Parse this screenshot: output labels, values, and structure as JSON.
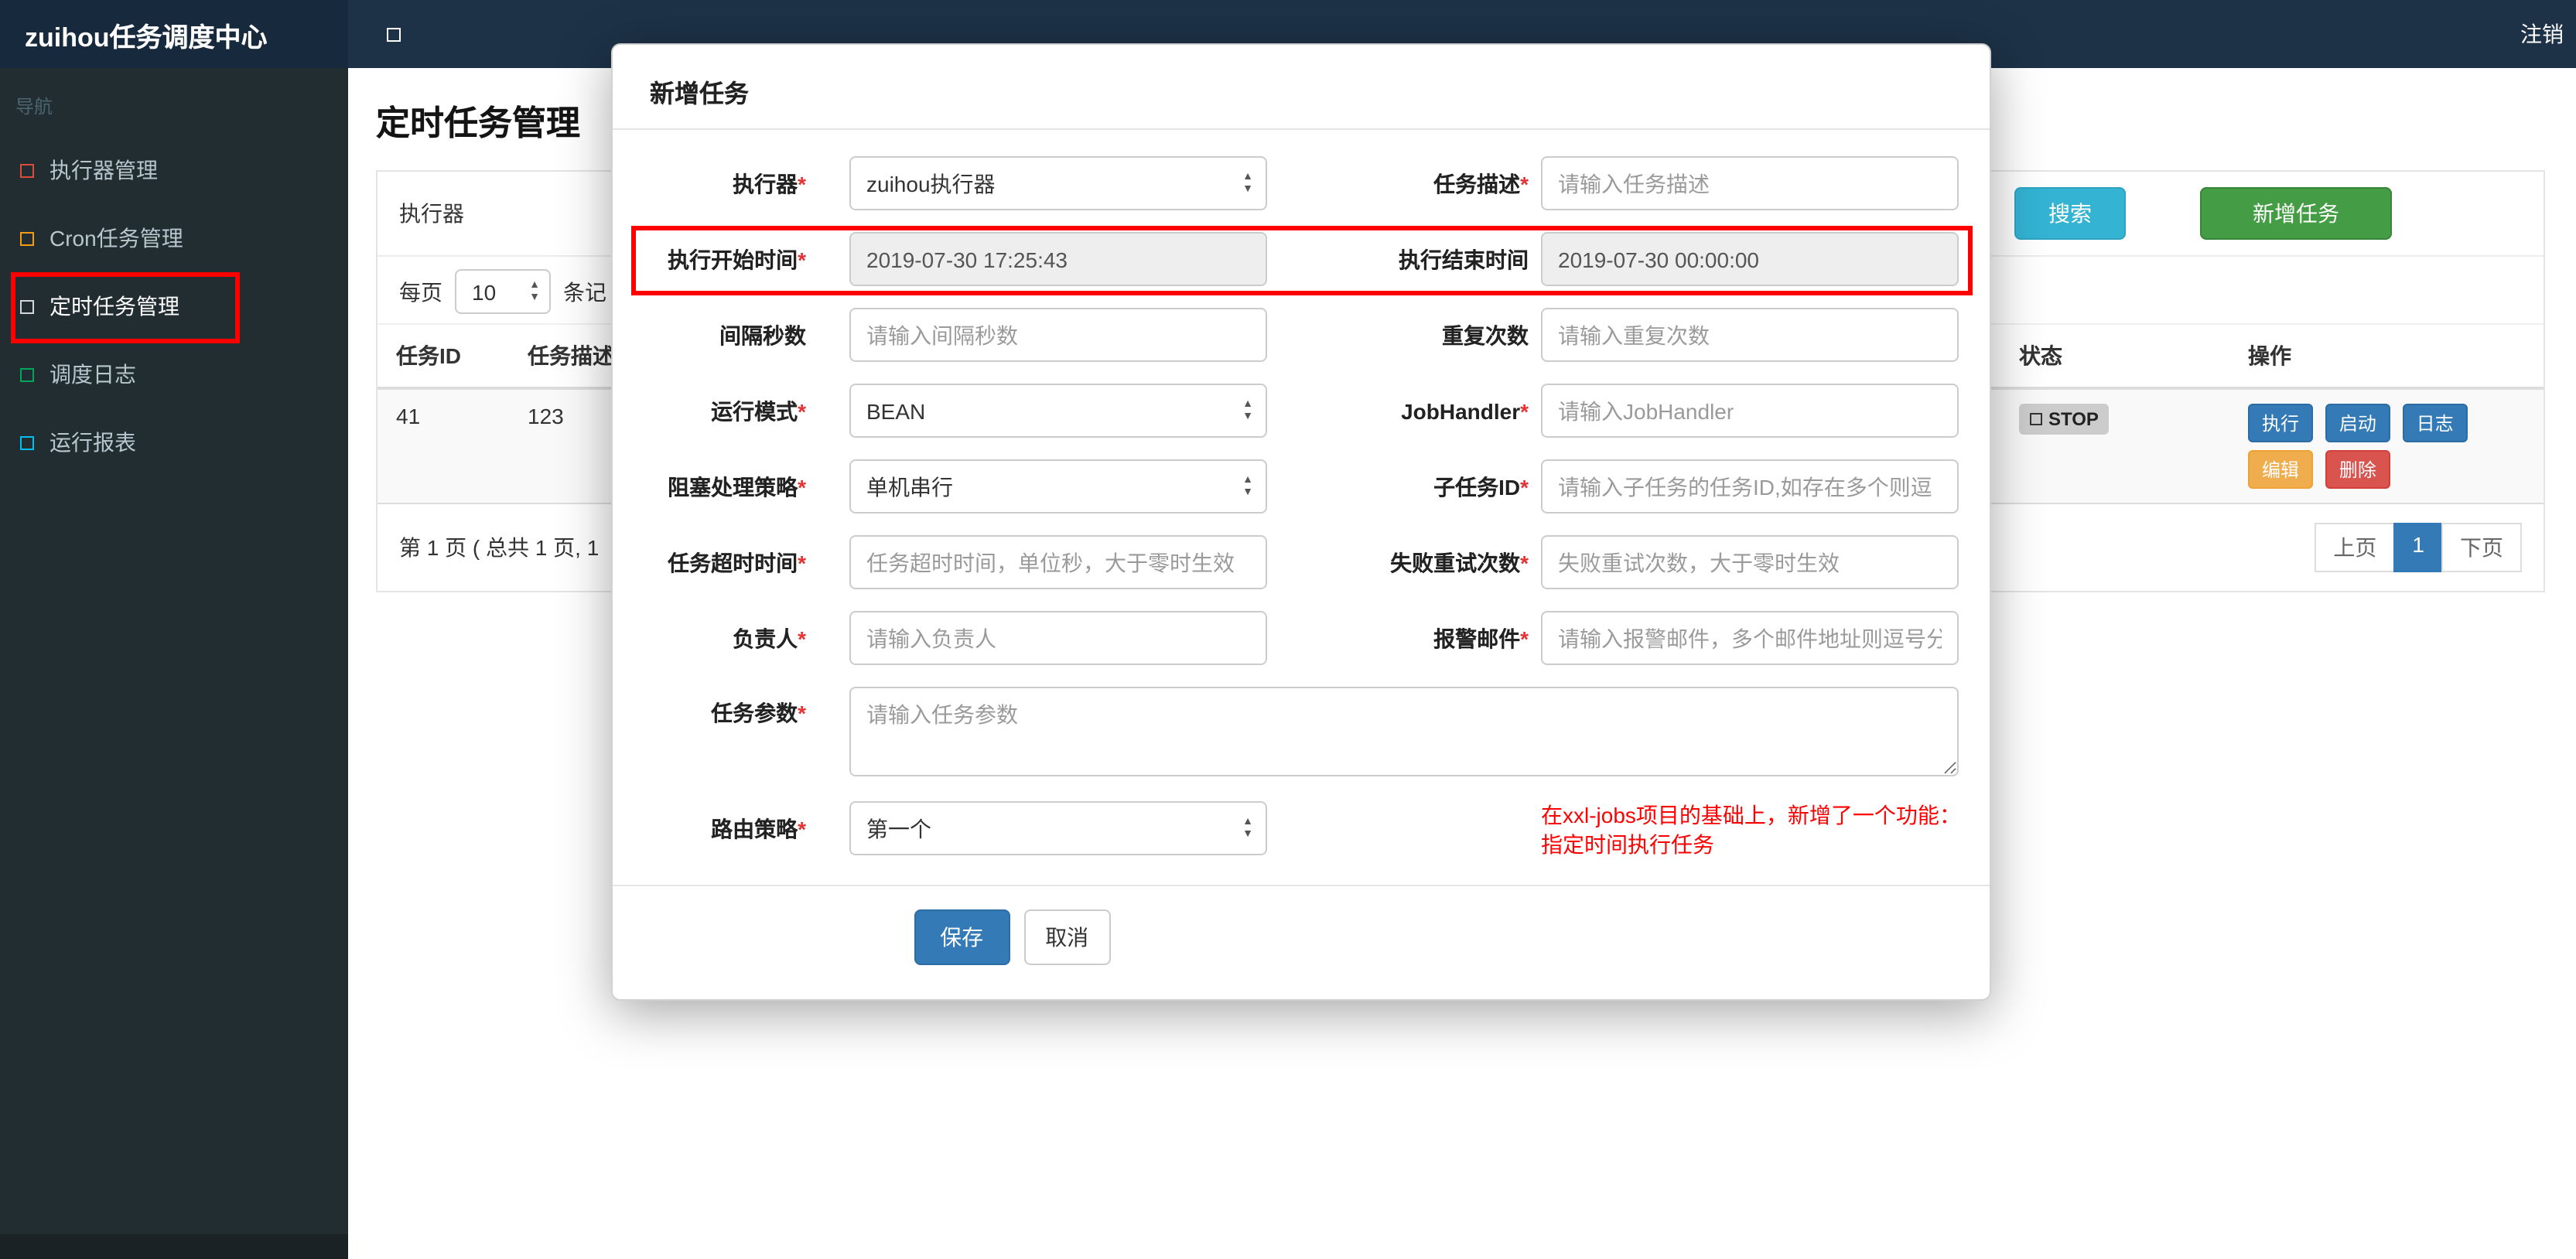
{
  "topbar": {
    "brand": "zuihou任务调度中心",
    "logout": "注销"
  },
  "sidebar": {
    "section_title": "导航",
    "items": [
      {
        "label": "执行器管理",
        "icon": "square-outline-icon",
        "icon_color": "#dd4b39"
      },
      {
        "label": "Cron任务管理",
        "icon": "square-outline-icon",
        "icon_color": "#f39c12"
      },
      {
        "label": "定时任务管理",
        "icon": "square-outline-icon",
        "icon_color": "#d2d6de",
        "annotated": true
      },
      {
        "label": "调度日志",
        "icon": "square-outline-icon",
        "icon_color": "#00a65a"
      },
      {
        "label": "运行报表",
        "icon": "square-outline-icon",
        "icon_color": "#00c0ef"
      }
    ]
  },
  "page": {
    "title": "定时任务管理",
    "filter": {
      "executor_label": "执行器",
      "search_button": "搜索",
      "add_button": "新增任务"
    },
    "per_page": {
      "prefix": "每页",
      "value": "10",
      "suffix": "条记"
    },
    "table": {
      "headers": [
        "任务ID",
        "任务描述",
        "状态",
        "操作"
      ],
      "rows": [
        {
          "id": "41",
          "desc": "123",
          "status": "STOP",
          "actions": [
            "执行",
            "启动",
            "日志",
            "编辑",
            "删除"
          ]
        }
      ]
    },
    "pagination": {
      "info": "第 1 页 ( 总共 1 页, 1",
      "prev": "上页",
      "current": "1",
      "next": "下页"
    }
  },
  "modal": {
    "title": "新增任务",
    "fields": {
      "executor": {
        "label": "执行器",
        "required": "*",
        "value": "zuihou执行器"
      },
      "job_desc": {
        "label": "任务描述",
        "required": "*",
        "placeholder": "请输入任务描述"
      },
      "start_time": {
        "label": "执行开始时间",
        "required": "*",
        "value": "2019-07-30 17:25:43"
      },
      "end_time": {
        "label": "执行结束时间",
        "value": "2019-07-30 00:00:00"
      },
      "interval_seconds": {
        "label": "间隔秒数",
        "placeholder": "请输入间隔秒数"
      },
      "repeat_count": {
        "label": "重复次数",
        "placeholder": "请输入重复次数"
      },
      "run_mode": {
        "label": "运行模式",
        "required": "*",
        "value": "BEAN"
      },
      "job_handler": {
        "label": "JobHandler",
        "required": "*",
        "placeholder": "请输入JobHandler"
      },
      "block_strategy": {
        "label": "阻塞处理策略",
        "required": "*",
        "value": "单机串行"
      },
      "child_job_id": {
        "label": "子任务ID",
        "required": "*",
        "placeholder": "请输入子任务的任务ID,如存在多个则逗"
      },
      "timeout": {
        "label": "任务超时时间",
        "required": "*",
        "placeholder": "任务超时时间，单位秒，大于零时生效"
      },
      "fail_retry": {
        "label": "失败重试次数",
        "required": "*",
        "placeholder": "失败重试次数，大于零时生效"
      },
      "owner": {
        "label": "负责人",
        "required": "*",
        "placeholder": "请输入负责人"
      },
      "alarm_email": {
        "label": "报警邮件",
        "required": "*",
        "placeholder": "请输入报警邮件，多个邮件地址则逗号分"
      },
      "job_params": {
        "label": "任务参数",
        "required": "*",
        "placeholder": "请输入任务参数"
      },
      "route_strategy": {
        "label": "路由策略",
        "required": "*",
        "value": "第一个"
      }
    },
    "note_line1": "在xxl-jobs项目的基础上，新增了一个功能：",
    "note_line2": "指定时间执行任务",
    "save_button": "保存",
    "cancel_button": "取消"
  },
  "icons": {
    "sidebar_toggle": "square-outline",
    "nav_item": "square-outline",
    "select_caret": "up-down-arrows",
    "status_square": "square-outline"
  },
  "colors": {
    "topbar_bg": "#1d3247",
    "brand_bg": "#17293c",
    "sidebar_bg": "#222d32",
    "search_button": "#34b3d3",
    "add_button": "#449d44",
    "primary": "#337ab7",
    "warning": "#f0ad4e",
    "danger": "#d9534f",
    "status_badge_bg": "#cccccc",
    "annotation_red": "#ff0000",
    "note_red": "#ff0000"
  }
}
